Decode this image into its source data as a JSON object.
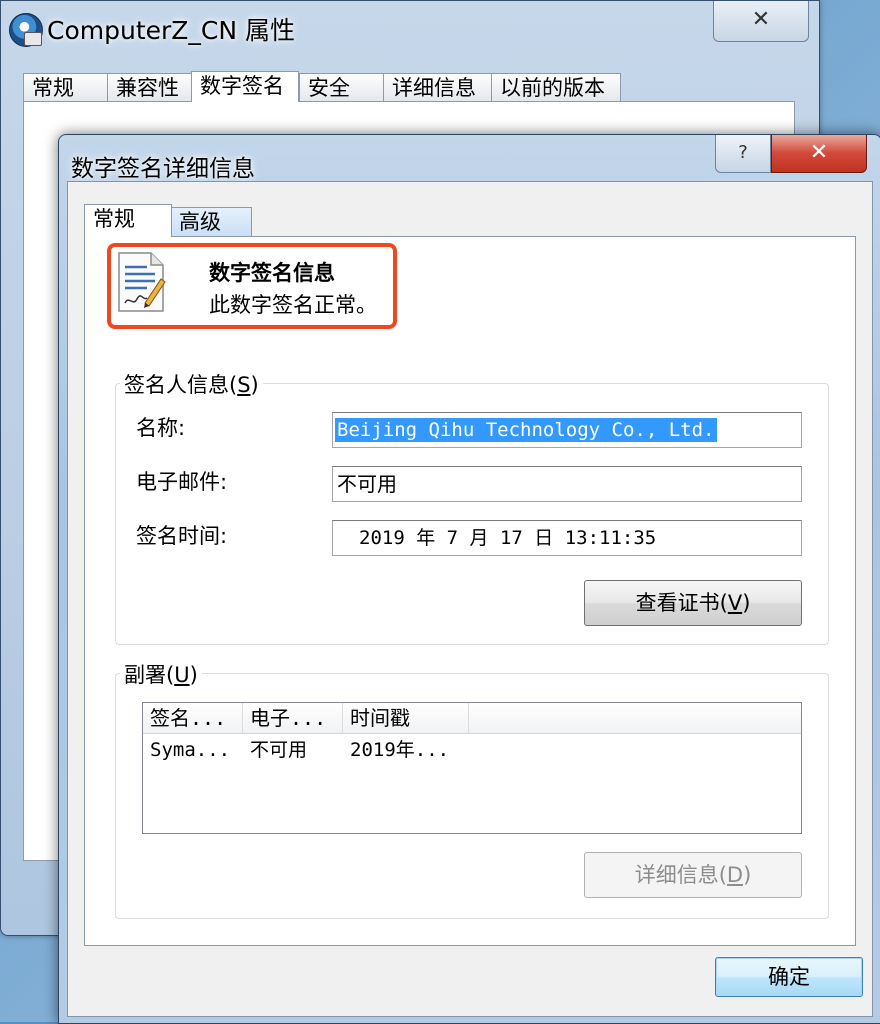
{
  "background_window": {
    "title": "ComputerZ_CN 属性",
    "close_glyph": "✕",
    "tabs": [
      "常规",
      "兼容性",
      "数字签名",
      "安全",
      "详细信息",
      "以前的版本"
    ],
    "active_tab": "数字签名"
  },
  "dialog": {
    "title": "数字签名详细信息",
    "help_glyph": "?",
    "close_glyph": "✕",
    "tabs": {
      "general": "常规",
      "advanced": "高级"
    },
    "header": {
      "title": "数字签名信息",
      "status": "此数字签名正常。"
    },
    "signer": {
      "legend_text": "签名人信息",
      "legend_key": "S",
      "name_label": "名称:",
      "name_value": "Beijing Qihu Technology Co., Ltd.",
      "email_label": "电子邮件:",
      "email_value": "不可用",
      "time_label": "签名时间:",
      "time_value": "2019  年  7  月  17  日 13:11:35",
      "view_cert_text": "查看证书",
      "view_cert_key": "V"
    },
    "countersignatures": {
      "legend_text": "副署",
      "legend_key": "U",
      "columns": [
        "签名...",
        "电子...",
        "时间戳"
      ],
      "rows": [
        [
          "Syma...",
          "不可用",
          "2019年..."
        ]
      ],
      "details_text": "详细信息",
      "details_key": "D"
    },
    "ok_label": "确定"
  },
  "colors": {
    "highlight_border": "#f0471f",
    "selection": "#3399ff",
    "close_button_red": "#c0331f"
  },
  "icons": {
    "app_icon": "computerz-app-icon",
    "header_icon": "signed-document-icon"
  }
}
